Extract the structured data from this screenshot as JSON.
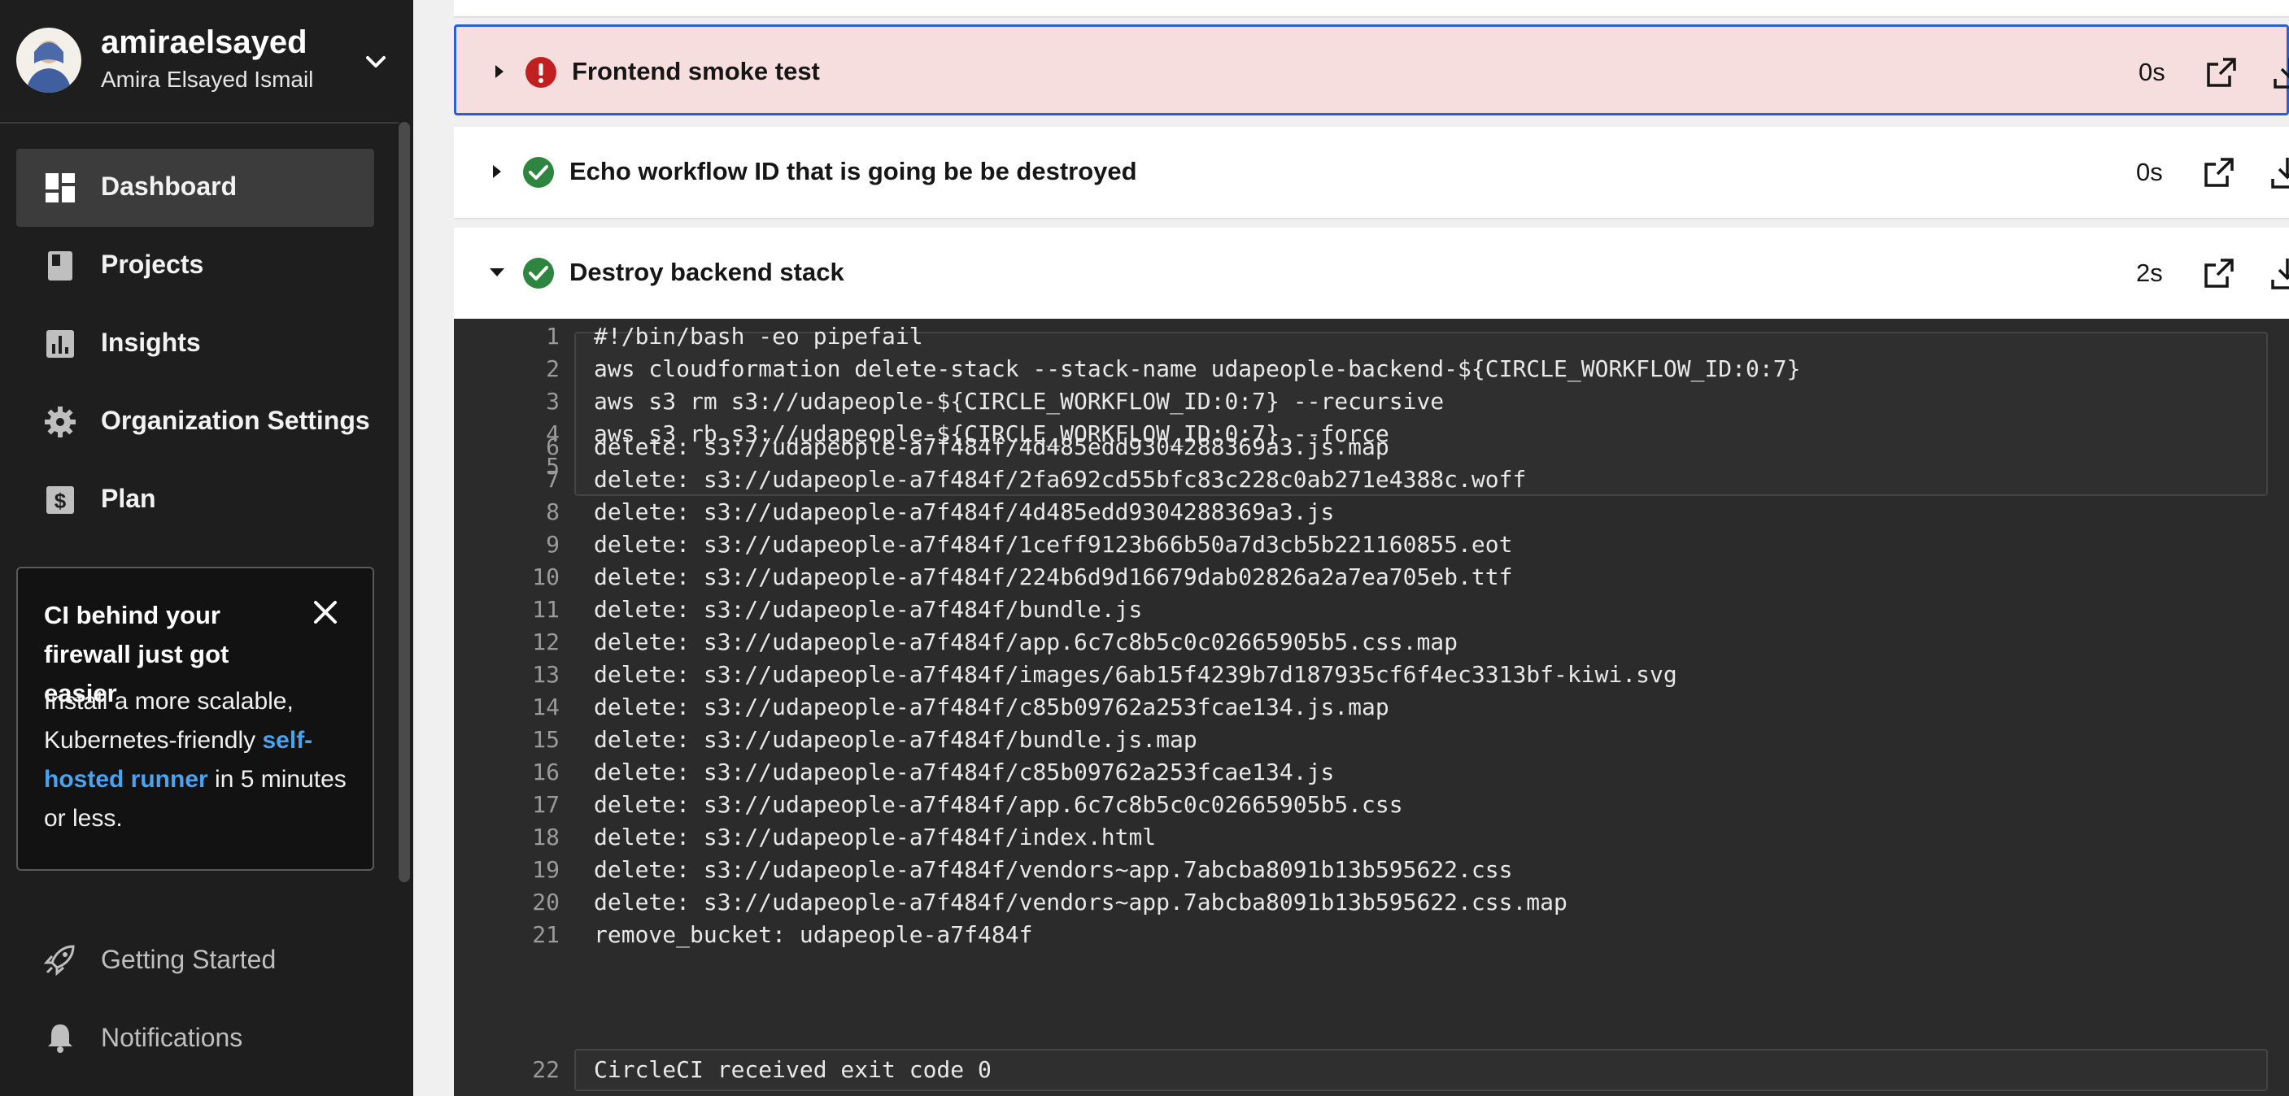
{
  "sidebar": {
    "user": {
      "username": "amiraelsayed",
      "full_name": "Amira Elsayed Ismail"
    },
    "nav": [
      {
        "label": "Dashboard",
        "icon": "dashboard-icon",
        "active": true
      },
      {
        "label": "Projects",
        "icon": "projects-icon"
      },
      {
        "label": "Insights",
        "icon": "insights-icon"
      },
      {
        "label": "Organization Settings",
        "icon": "gear-icon"
      },
      {
        "label": "Plan",
        "icon": "dollar-icon"
      }
    ],
    "promo": {
      "title": "CI behind your firewall just got easier",
      "body_before": "Install a more scalable, Kubernetes-friendly ",
      "link": "self-hosted runner",
      "body_after": " in 5 minutes or less."
    },
    "bottom": [
      {
        "label": "Getting Started",
        "icon": "rocket-icon"
      },
      {
        "label": "Notifications",
        "icon": "bell-icon"
      }
    ]
  },
  "steps": [
    {
      "title": "Frontend smoke test",
      "duration": "0s",
      "status": "failed",
      "expanded": false
    },
    {
      "title": "Echo workflow ID that is going be be destroyed",
      "duration": "0s",
      "status": "success",
      "expanded": false
    },
    {
      "title": "Destroy backend stack",
      "duration": "2s",
      "status": "success",
      "expanded": true
    }
  ],
  "log": {
    "lines": [
      {
        "n": "1",
        "text": "#!/bin/bash -eo pipefail"
      },
      {
        "n": "2",
        "text": "aws cloudformation delete-stack --stack-name udapeople-backend-${CIRCLE_WORKFLOW_ID:0:7}"
      },
      {
        "n": "3",
        "text": "aws s3 rm s3://udapeople-${CIRCLE_WORKFLOW_ID:0:7} --recursive"
      },
      {
        "n": "4",
        "text": "aws s3 rb s3://udapeople-${CIRCLE_WORKFLOW_ID:0:7} --force"
      },
      {
        "n": "5",
        "text": ""
      },
      {
        "n": "6",
        "text": "delete: s3://udapeople-a7f484f/4d485edd9304288369a3.js.map"
      },
      {
        "n": "7",
        "text": "delete: s3://udapeople-a7f484f/2fa692cd55bfc83c228c0ab271e4388c.woff"
      },
      {
        "n": "8",
        "text": "delete: s3://udapeople-a7f484f/4d485edd9304288369a3.js"
      },
      {
        "n": "9",
        "text": "delete: s3://udapeople-a7f484f/1ceff9123b66b50a7d3cb5b221160855.eot"
      },
      {
        "n": "10",
        "text": "delete: s3://udapeople-a7f484f/224b6d9d16679dab02826a2a7ea705eb.ttf"
      },
      {
        "n": "11",
        "text": "delete: s3://udapeople-a7f484f/bundle.js"
      },
      {
        "n": "12",
        "text": "delete: s3://udapeople-a7f484f/app.6c7c8b5c0c02665905b5.css.map"
      },
      {
        "n": "13",
        "text": "delete: s3://udapeople-a7f484f/images/6ab15f4239b7d187935cf6f4ec3313bf-kiwi.svg"
      },
      {
        "n": "14",
        "text": "delete: s3://udapeople-a7f484f/c85b09762a253fcae134.js.map"
      },
      {
        "n": "15",
        "text": "delete: s3://udapeople-a7f484f/bundle.js.map"
      },
      {
        "n": "16",
        "text": "delete: s3://udapeople-a7f484f/c85b09762a253fcae134.js"
      },
      {
        "n": "17",
        "text": "delete: s3://udapeople-a7f484f/app.6c7c8b5c0c02665905b5.css"
      },
      {
        "n": "18",
        "text": "delete: s3://udapeople-a7f484f/index.html"
      },
      {
        "n": "19",
        "text": "delete: s3://udapeople-a7f484f/vendors~app.7abcba8091b13b595622.css"
      },
      {
        "n": "20",
        "text": "delete: s3://udapeople-a7f484f/vendors~app.7abcba8091b13b595622.css.map"
      },
      {
        "n": "21",
        "text": "remove_bucket: udapeople-a7f484f"
      },
      {
        "n": "22",
        "text": "CircleCI received exit code 0"
      }
    ]
  },
  "colors": {
    "sidebar_bg": "#1e1e1e",
    "failed_bg": "#f7dede",
    "failed_icon": "#c0201f",
    "success_icon": "#2e8540",
    "link": "#4aa3f0",
    "log_bg": "#2b2b2b"
  }
}
